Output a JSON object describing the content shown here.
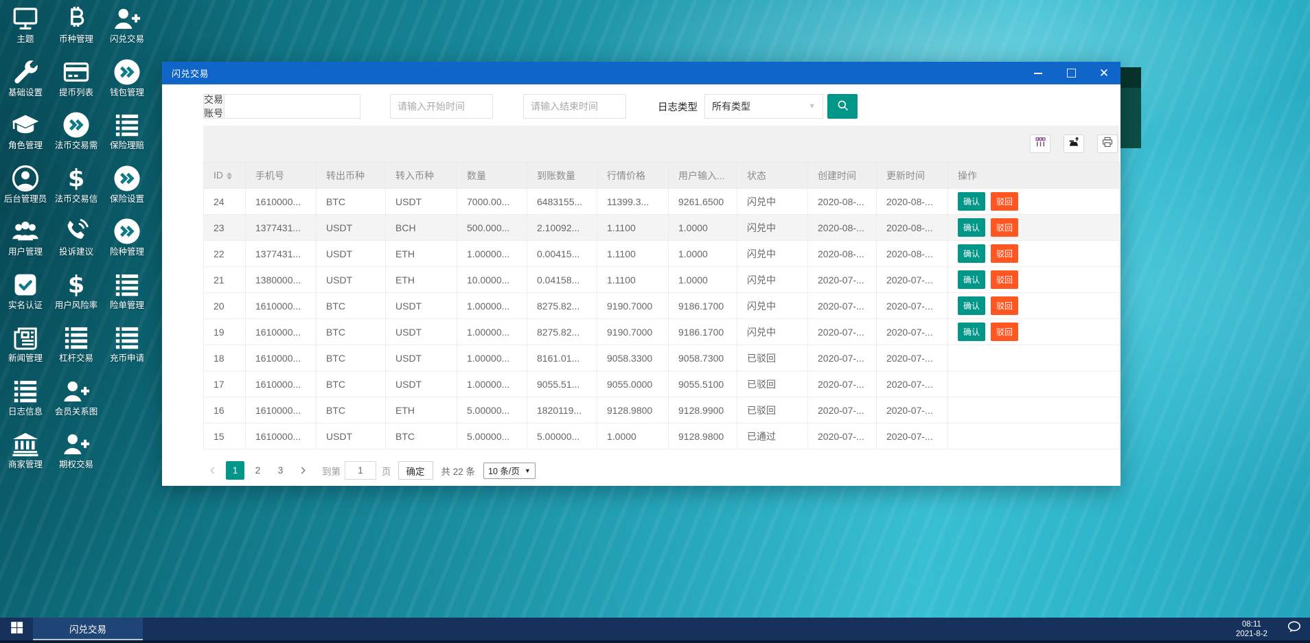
{
  "colors": {
    "accent_teal": "#009688",
    "accent_orange": "#ff5722",
    "titlebar_blue": "#1066c8",
    "taskbar_navy": "#16325c"
  },
  "desktop": {
    "icons": [
      {
        "label": "主题",
        "icon": "monitor-icon"
      },
      {
        "label": "币种管理",
        "icon": "bitcoin-icon"
      },
      {
        "label": "闪兑交易",
        "icon": "user-plus-icon"
      },
      {
        "label": "基础设置",
        "icon": "wrench-icon"
      },
      {
        "label": "提币列表",
        "icon": "credit-card-icon"
      },
      {
        "label": "钱包管理",
        "icon": "exchange-circle-icon"
      },
      {
        "label": "角色管理",
        "icon": "graduation-cap-icon"
      },
      {
        "label": "法币交易需",
        "icon": "exchange-circle-icon"
      },
      {
        "label": "保险理赔",
        "icon": "list-icon"
      },
      {
        "label": "后台管理员",
        "icon": "user-circle-icon"
      },
      {
        "label": "法币交易信",
        "icon": "dollar-icon"
      },
      {
        "label": "保险设置",
        "icon": "exchange-circle-icon"
      },
      {
        "label": "用户管理",
        "icon": "users-icon"
      },
      {
        "label": "投诉建议",
        "icon": "phone-volume-icon"
      },
      {
        "label": "险种管理",
        "icon": "exchange-circle-icon"
      },
      {
        "label": "实名认证",
        "icon": "check-square-icon"
      },
      {
        "label": "用户风险率",
        "icon": "dollar-icon"
      },
      {
        "label": "险单管理",
        "icon": "list-icon"
      },
      {
        "label": "新闻管理",
        "icon": "newspaper-icon"
      },
      {
        "label": "杠杆交易",
        "icon": "list-icon"
      },
      {
        "label": "充币申请",
        "icon": "list-icon"
      },
      {
        "label": "日志信息",
        "icon": "list-icon"
      },
      {
        "label": "会员关系图",
        "icon": "user-plus-icon"
      },
      {
        "label": "商家管理",
        "icon": "bank-icon"
      },
      {
        "label": "期权交易",
        "icon": "user-plus-icon"
      }
    ]
  },
  "window": {
    "title": "闪兑交易",
    "controls": {
      "minimize": "minimize-icon",
      "maximize": "maximize-icon",
      "close": "close-icon",
      "close_glyph": "✕"
    },
    "search": {
      "account_label": "交易账号",
      "account_value": "",
      "start_placeholder": "请输入开始时间",
      "end_placeholder": "请输入结束时间",
      "log_type_label": "日志类型",
      "log_type_value": "所有类型",
      "search_icon": "search-icon"
    },
    "toolbar": {
      "icons": [
        "columns-icon",
        "export-icon",
        "print-icon"
      ]
    },
    "table": {
      "headers": [
        "ID",
        "手机号",
        "转出币种",
        "转入币种",
        "数量",
        "到账数量",
        "行情价格",
        "用户输入...",
        "状态",
        "创建时间",
        "更新时间",
        "操作"
      ],
      "confirm_label": "确认",
      "reject_label": "驳回",
      "rows": [
        {
          "id": "24",
          "phone": "1610000...",
          "from_coin": "BTC",
          "to_coin": "USDT",
          "amount": "7000.00...",
          "received": "6483155...",
          "price": "11399.3...",
          "user_input": "9261.6500",
          "status": "闪兑中",
          "created": "2020-08-...",
          "updated": "2020-08-...",
          "has_actions": true,
          "highlighted": false
        },
        {
          "id": "23",
          "phone": "1377431...",
          "from_coin": "USDT",
          "to_coin": "BCH",
          "amount": "500.000...",
          "received": "2.10092...",
          "price": "1.1100",
          "user_input": "1.0000",
          "status": "闪兑中",
          "created": "2020-08-...",
          "updated": "2020-08-...",
          "has_actions": true,
          "highlighted": true
        },
        {
          "id": "22",
          "phone": "1377431...",
          "from_coin": "USDT",
          "to_coin": "ETH",
          "amount": "1.00000...",
          "received": "0.00415...",
          "price": "1.1100",
          "user_input": "1.0000",
          "status": "闪兑中",
          "created": "2020-08-...",
          "updated": "2020-08-...",
          "has_actions": true,
          "highlighted": false
        },
        {
          "id": "21",
          "phone": "1380000...",
          "from_coin": "USDT",
          "to_coin": "ETH",
          "amount": "10.0000...",
          "received": "0.04158...",
          "price": "1.1100",
          "user_input": "1.0000",
          "status": "闪兑中",
          "created": "2020-07-...",
          "updated": "2020-07-...",
          "has_actions": true,
          "highlighted": false
        },
        {
          "id": "20",
          "phone": "1610000...",
          "from_coin": "BTC",
          "to_coin": "USDT",
          "amount": "1.00000...",
          "received": "8275.82...",
          "price": "9190.7000",
          "user_input": "9186.1700",
          "status": "闪兑中",
          "created": "2020-07-...",
          "updated": "2020-07-...",
          "has_actions": true,
          "highlighted": false
        },
        {
          "id": "19",
          "phone": "1610000...",
          "from_coin": "BTC",
          "to_coin": "USDT",
          "amount": "1.00000...",
          "received": "8275.82...",
          "price": "9190.7000",
          "user_input": "9186.1700",
          "status": "闪兑中",
          "created": "2020-07-...",
          "updated": "2020-07-...",
          "has_actions": true,
          "highlighted": false
        },
        {
          "id": "18",
          "phone": "1610000...",
          "from_coin": "BTC",
          "to_coin": "USDT",
          "amount": "1.00000...",
          "received": "8161.01...",
          "price": "9058.3300",
          "user_input": "9058.7300",
          "status": "已驳回",
          "created": "2020-07-...",
          "updated": "2020-07-...",
          "has_actions": false,
          "highlighted": false
        },
        {
          "id": "17",
          "phone": "1610000...",
          "from_coin": "BTC",
          "to_coin": "USDT",
          "amount": "1.00000...",
          "received": "9055.51...",
          "price": "9055.0000",
          "user_input": "9055.5100",
          "status": "已驳回",
          "created": "2020-07-...",
          "updated": "2020-07-...",
          "has_actions": false,
          "highlighted": false
        },
        {
          "id": "16",
          "phone": "1610000...",
          "from_coin": "BTC",
          "to_coin": "ETH",
          "amount": "5.00000...",
          "received": "1820119...",
          "price": "9128.9800",
          "user_input": "9128.9900",
          "status": "已驳回",
          "created": "2020-07-...",
          "updated": "2020-07-...",
          "has_actions": false,
          "highlighted": false
        },
        {
          "id": "15",
          "phone": "1610000...",
          "from_coin": "USDT",
          "to_coin": "BTC",
          "amount": "5.00000...",
          "received": "5.00000...",
          "price": "1.0000",
          "user_input": "9128.9800",
          "status": "已通过",
          "created": "2020-07-...",
          "updated": "2020-07-...",
          "has_actions": false,
          "highlighted": false
        }
      ]
    },
    "pagination": {
      "pages": [
        "1",
        "2",
        "3"
      ],
      "active_page": "1",
      "goto_label": "到第",
      "goto_value": "1",
      "page_word": "页",
      "confirm_label": "确定",
      "total_label": "共 22 条",
      "per_page_value": "10 条/页"
    }
  },
  "taskbar": {
    "start_icon": "windows-logo-icon",
    "task_label": "闪兑交易",
    "clock_time": "08:11",
    "clock_date": "2021-8-2",
    "chat_icon": "chat-bubble-icon"
  }
}
